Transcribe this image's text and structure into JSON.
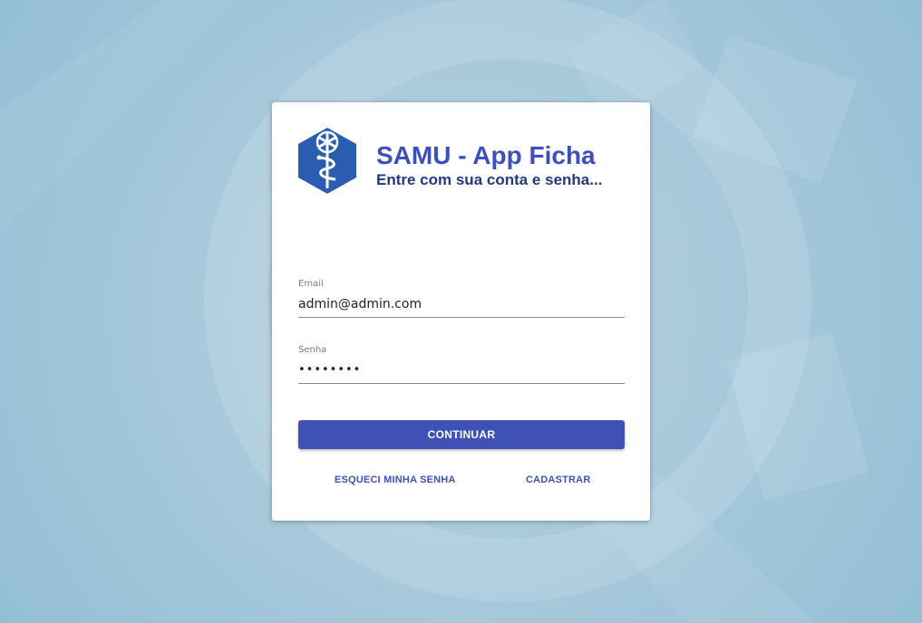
{
  "header": {
    "title": "SAMU - App Ficha",
    "subtitle": "Entre com sua conta e senha..."
  },
  "logo": {
    "icon": "samu-star-of-life-icon",
    "color": "#2a5db0"
  },
  "form": {
    "email": {
      "label": "Email",
      "value": "admin@admin.com"
    },
    "password": {
      "label": "Senha",
      "value": "••••••••"
    }
  },
  "actions": {
    "continue_label": "CONTINUAR",
    "forgot_label": "ESQUECI MINHA SENHA",
    "register_label": "CADASTRAR"
  },
  "colors": {
    "primary": "#3f51b5",
    "title": "#3d4fbb",
    "subtitle": "#233a7e",
    "background": "#a9cadb"
  }
}
